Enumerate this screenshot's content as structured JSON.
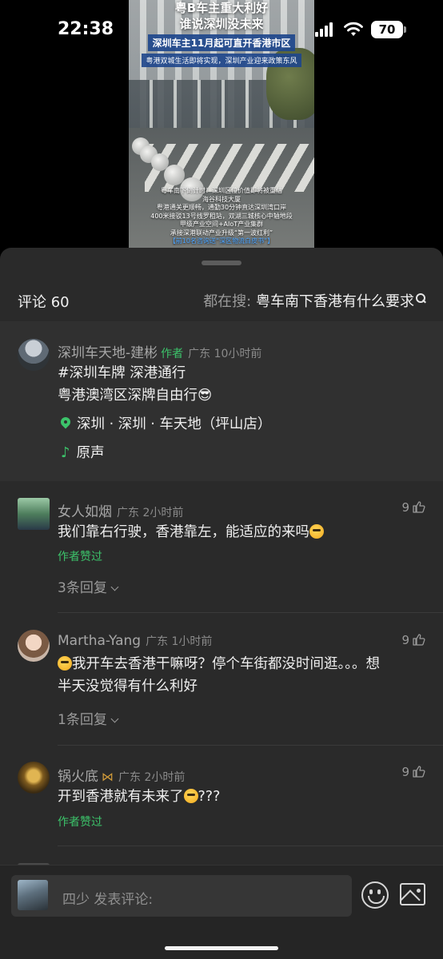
{
  "status_bar": {
    "time": "22:38",
    "battery": "70"
  },
  "video": {
    "title_line1": "粤B车主重大利好",
    "title_line2": "谁说深圳没未来",
    "banner": "深圳车主11月起可直开香港市区",
    "sub_banner": "粤港双城生活即将实现，深圳产业迎来政策东风",
    "caption_lines": [
      "粤车南下倒计时！深圳区位价值即将被重估",
      "海谷科技大厦",
      "粤港通关更顺畅，通勤30分钟直达深圳湾口岸",
      "400米接驳13号线罗租站，双湖三城核心中轴地段",
      "甲级产业空间+AIoT产业集群",
      "承接深港联动产业升级“第一波红利”"
    ],
    "caption_last": "【前10名咨询送“深区物流白皮书”】"
  },
  "comments_panel": {
    "count_label": "评论 60",
    "search_label": "都在搜:",
    "search_query": "粤车南下香港有什么要求"
  },
  "post": {
    "username": "深圳车天地-建彬",
    "author_tag": "作者",
    "location_time": "广东 10小时前",
    "line1": "#深圳车牌 深港通行",
    "line2": "粤港澳湾区深牌自由行😎",
    "location": "深圳 · 深圳 · 车天地（坪山店）",
    "sound": "原声"
  },
  "comments": [
    {
      "username": "女人如烟",
      "location_time": "广东 2小时前",
      "likes": "9",
      "text": "我们靠右行驶，香港靠左，能适应的来吗",
      "author_liked": "作者赞过",
      "replies": "3条回复"
    },
    {
      "username": "Martha-Yang",
      "location_time": "广东 1小时前",
      "likes": "9",
      "text_line1": "我开车去香港干嘛呀？停个车街都没时间逛。。。想",
      "text_line2": "半天没觉得有什么利好",
      "replies": "1条回复"
    },
    {
      "username": "锅火底",
      "location_time": "广东 2小时前",
      "likes": "9",
      "text": "开到香港就有未来了",
      "text_suffix": "???",
      "author_liked": "作者赞过"
    }
  ],
  "input_bar": {
    "username": "四少",
    "placeholder": "发表评论:"
  }
}
